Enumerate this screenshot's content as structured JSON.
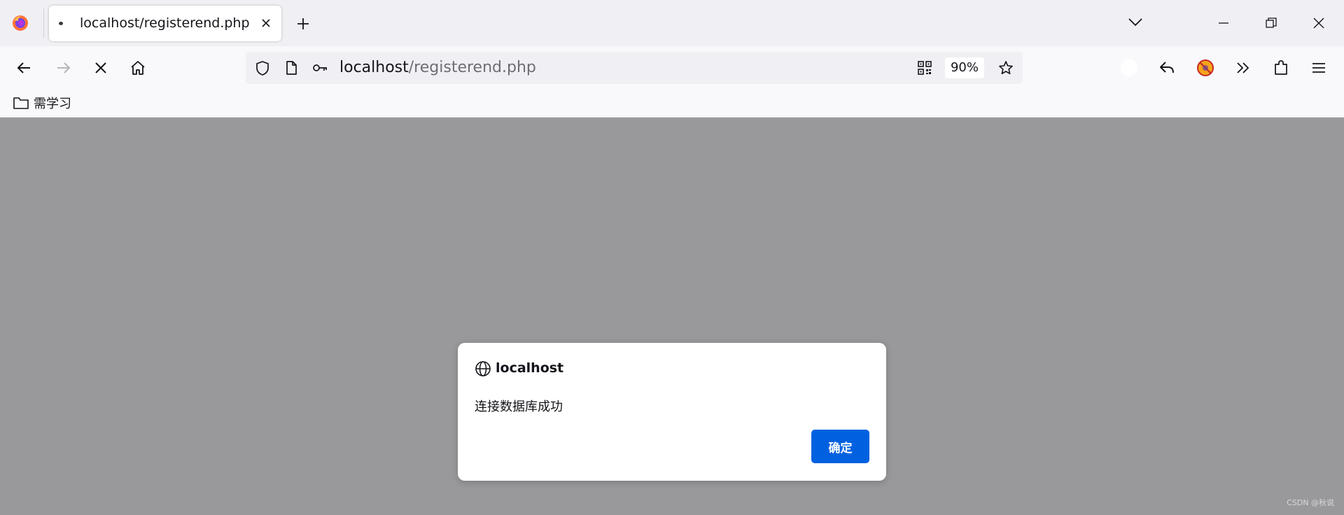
{
  "tab": {
    "title": "localhost/registerend.php",
    "favicon": "globe-dot"
  },
  "icons": {
    "browser_logo": "firefox-logo",
    "tab_close": "close-icon",
    "new_tab": "plus-icon",
    "list_tabs": "chevron-down-icon",
    "window_minimize": "minimize-icon",
    "window_restore": "restore-icon",
    "window_close": "close-icon",
    "back": "arrow-left-icon",
    "forward": "arrow-right-icon",
    "stop": "close-icon",
    "home": "home-icon",
    "tracking": "shield-icon",
    "page_info": "document-icon",
    "key": "key-icon",
    "qr": "qr-code-icon",
    "bookmark": "star-icon",
    "account": "circle-icon",
    "reply": "reply-icon",
    "blocker": "blocked-extension-icon",
    "overflow": "double-chevron-icon",
    "extensions": "puzzle-icon",
    "menu": "hamburger-menu-icon",
    "folder": "folder-icon",
    "globe": "globe-icon"
  },
  "url": {
    "host": "localhost",
    "path": "/registerend.php"
  },
  "zoom": "90%",
  "bookmarks": [
    {
      "label": "需学习"
    }
  ],
  "dialog": {
    "origin": "localhost",
    "message": "连接数据库成功",
    "ok_label": "确定"
  },
  "watermark": "CSDN @秋说",
  "colors": {
    "accent": "#0061e0",
    "overlay": "#99999b",
    "toolbar": "#f9f9fb",
    "tabstrip": "#f0f0f4"
  }
}
